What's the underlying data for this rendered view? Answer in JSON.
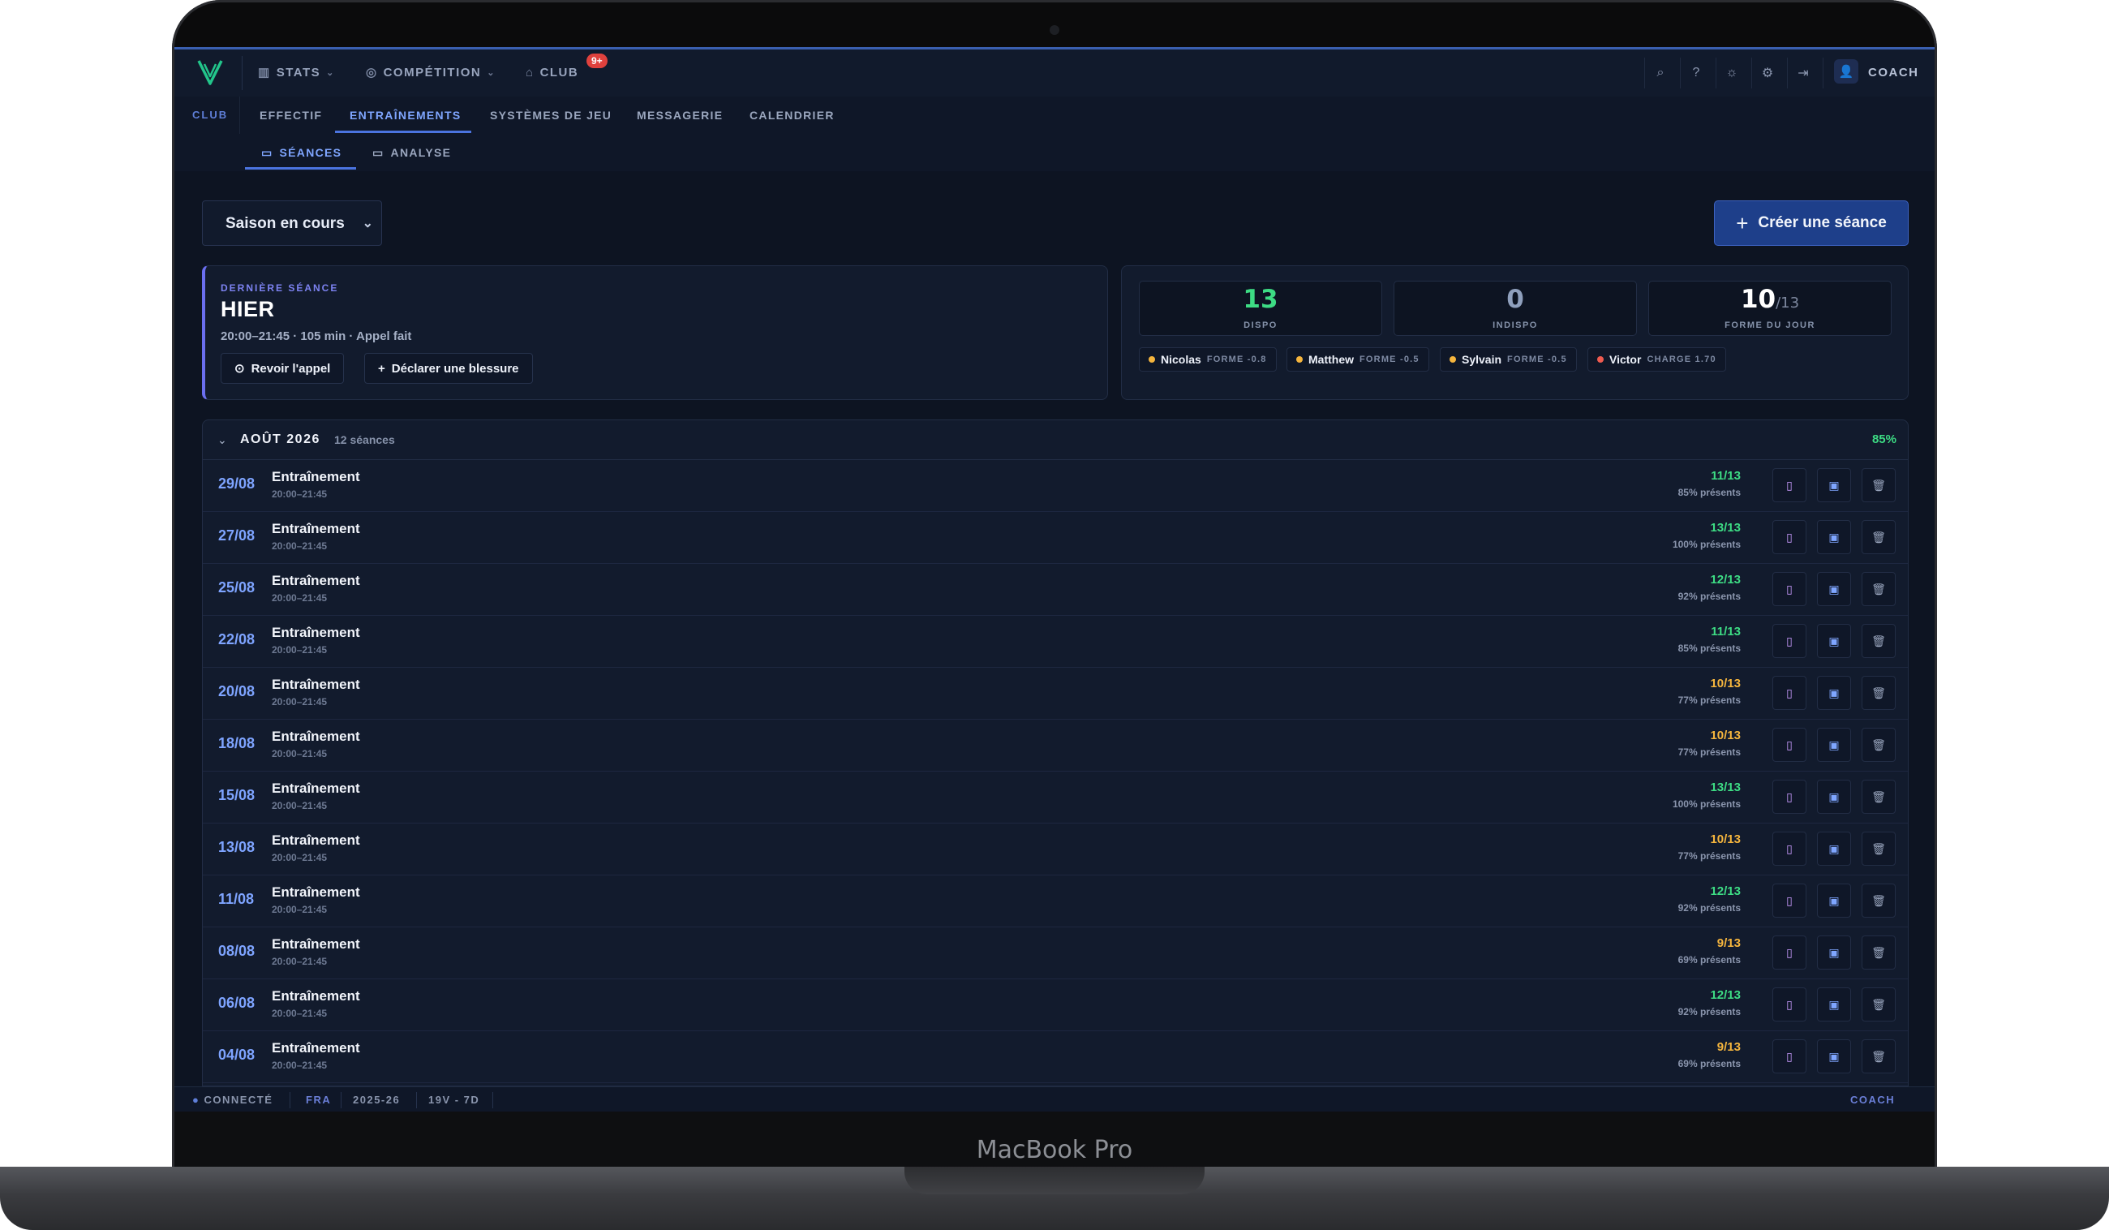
{
  "device": {
    "label": "MacBook Pro"
  },
  "topnav": {
    "items": [
      {
        "label": "STATS",
        "icon": "bar-chart-icon"
      },
      {
        "label": "COMPÉTITION",
        "icon": "trophy-icon"
      },
      {
        "label": "CLUB",
        "icon": "club-icon"
      }
    ],
    "club_badge": "9+",
    "user_label": "COACH"
  },
  "subnav": {
    "section": "CLUB",
    "tabs": [
      "EFFECTIF",
      "ENTRAÎNEMENTS",
      "SYSTÈMES DE JEU",
      "MESSAGERIE",
      "CALENDRIER"
    ],
    "active": "ENTRAÎNEMENTS"
  },
  "subtabs": {
    "items": [
      "SÉANCES",
      "ANALYSE"
    ],
    "active": "SÉANCES"
  },
  "filter": {
    "season": "Saison en cours"
  },
  "actions": {
    "create": "Créer une séance"
  },
  "last_session": {
    "kicker": "DERNIÈRE SÉANCE",
    "title": "HIER",
    "subtitle": "20:00–21:45 · 105 min · Appel fait",
    "review_btn": "Revoir l'appel",
    "injury_btn": "Déclarer une blessure"
  },
  "squad": {
    "dispo": "13",
    "dispo_label": "DISPO",
    "indispo": "0",
    "indispo_label": "INDISPO",
    "forme": "10",
    "forme_total": "/13",
    "forme_label": "FORME DU JOUR",
    "alerts": [
      {
        "name": "Nicolas",
        "value": "FORME -0.8",
        "color": "#f5b53d"
      },
      {
        "name": "Matthew",
        "value": "FORME -0.5",
        "color": "#f5b53d"
      },
      {
        "name": "Sylvain",
        "value": "FORME -0.5",
        "color": "#f5b53d"
      },
      {
        "name": "Victor",
        "value": "CHARGE 1.70",
        "color": "#ef5b50"
      }
    ]
  },
  "month": {
    "title": "AOÛT 2026",
    "count": "12 séances",
    "attendance": "85%",
    "sessions": [
      {
        "date": "29/08",
        "title": "Entraînement",
        "time": "20:00–21:45",
        "attendance": "11/13",
        "presence": "85% présents",
        "level": "green"
      },
      {
        "date": "27/08",
        "title": "Entraînement",
        "time": "20:00–21:45",
        "attendance": "13/13",
        "presence": "100% présents",
        "level": "green"
      },
      {
        "date": "25/08",
        "title": "Entraînement",
        "time": "20:00–21:45",
        "attendance": "12/13",
        "presence": "92% présents",
        "level": "green"
      },
      {
        "date": "22/08",
        "title": "Entraînement",
        "time": "20:00–21:45",
        "attendance": "11/13",
        "presence": "85% présents",
        "level": "green"
      },
      {
        "date": "20/08",
        "title": "Entraînement",
        "time": "20:00–21:45",
        "attendance": "10/13",
        "presence": "77% présents",
        "level": "yellow"
      },
      {
        "date": "18/08",
        "title": "Entraînement",
        "time": "20:00–21:45",
        "attendance": "10/13",
        "presence": "77% présents",
        "level": "yellow"
      },
      {
        "date": "15/08",
        "title": "Entraînement",
        "time": "20:00–21:45",
        "attendance": "13/13",
        "presence": "100% présents",
        "level": "green"
      },
      {
        "date": "13/08",
        "title": "Entraînement",
        "time": "20:00–21:45",
        "attendance": "10/13",
        "presence": "77% présents",
        "level": "yellow"
      },
      {
        "date": "11/08",
        "title": "Entraînement",
        "time": "20:00–21:45",
        "attendance": "12/13",
        "presence": "92% présents",
        "level": "green"
      },
      {
        "date": "08/08",
        "title": "Entraînement",
        "time": "20:00–21:45",
        "attendance": "9/13",
        "presence": "69% présents",
        "level": "yellow"
      },
      {
        "date": "06/08",
        "title": "Entraînement",
        "time": "20:00–21:45",
        "attendance": "12/13",
        "presence": "92% présents",
        "level": "green"
      },
      {
        "date": "04/08",
        "title": "Entraînement",
        "time": "20:00–21:45",
        "attendance": "9/13",
        "presence": "69% présents",
        "level": "yellow"
      }
    ]
  },
  "statusbar": {
    "connection": "CONNECTÉ",
    "team": "FRA",
    "season": "2025-26",
    "record": "19V - 7D",
    "role": "COACH"
  },
  "colors": {
    "accent": "#4b74e0",
    "green": "#3ddc84",
    "yellow": "#f5b53d",
    "red": "#ef5b50",
    "purple": "#7d83f2"
  }
}
